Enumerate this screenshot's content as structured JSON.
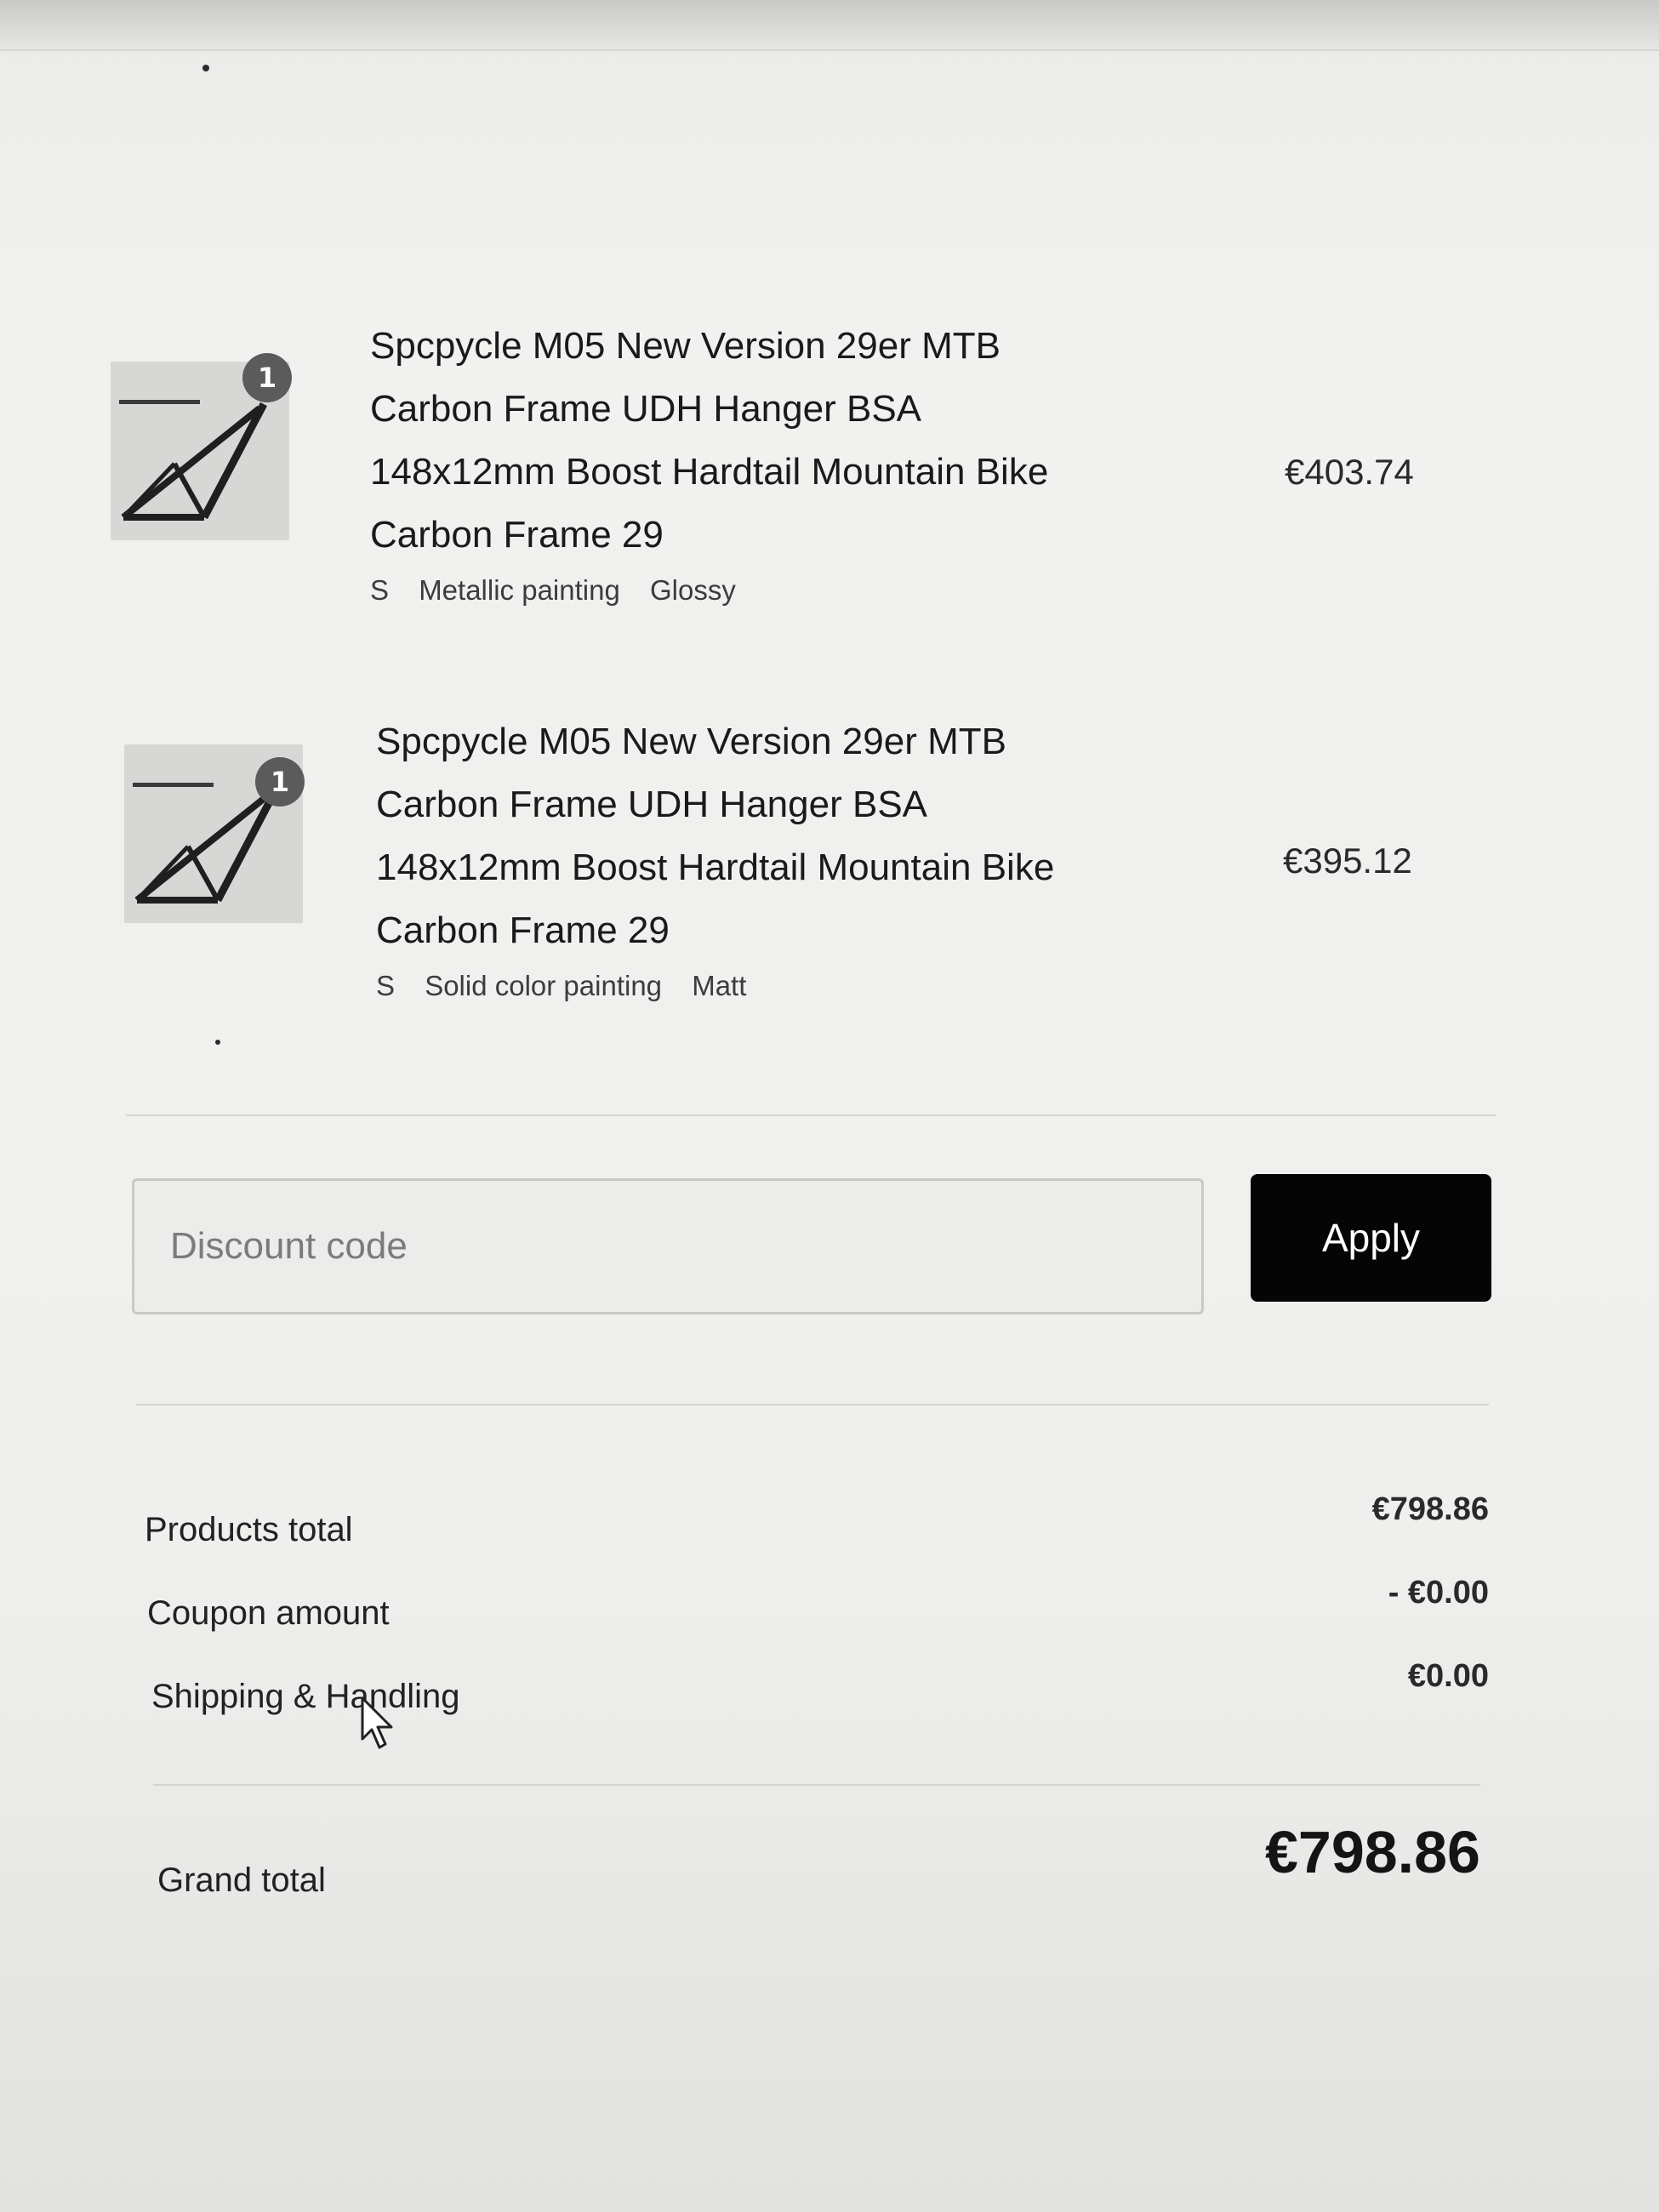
{
  "items": [
    {
      "title_lines": [
        "Spcpycle M05 New Version 29er MTB",
        "Carbon Frame UDH Hanger BSA",
        "148x12mm Boost Hardtail Mountain Bike",
        "Carbon Frame 29"
      ],
      "quantity": "1",
      "variants": [
        "S",
        "Metallic painting",
        "Glossy"
      ],
      "price": "€403.74",
      "thumbnail_icon": "bike-frame-icon"
    },
    {
      "title_lines": [
        "Spcpycle M05 New Version 29er MTB",
        "Carbon Frame UDH Hanger BSA",
        "148x12mm Boost Hardtail Mountain Bike",
        "Carbon Frame 29"
      ],
      "quantity": "1",
      "variants": [
        "S",
        "Solid color painting",
        "Matt"
      ],
      "price": "€395.12",
      "thumbnail_icon": "bike-frame-icon"
    }
  ],
  "discount": {
    "placeholder": "Discount code",
    "value": "",
    "apply_label": "Apply"
  },
  "totals": {
    "products_total_label": "Products total",
    "products_total_value": "€798.86",
    "coupon_label": "Coupon amount",
    "coupon_value": "- €0.00",
    "shipping_label": "Shipping & Handling",
    "shipping_value": "€0.00",
    "grand_total_label": "Grand total",
    "grand_total_value": "€798.86"
  },
  "colors": {
    "apply_button_bg": "#050505",
    "badge_bg": "#5b5b5b",
    "page_bg": "#f0f0ee"
  }
}
